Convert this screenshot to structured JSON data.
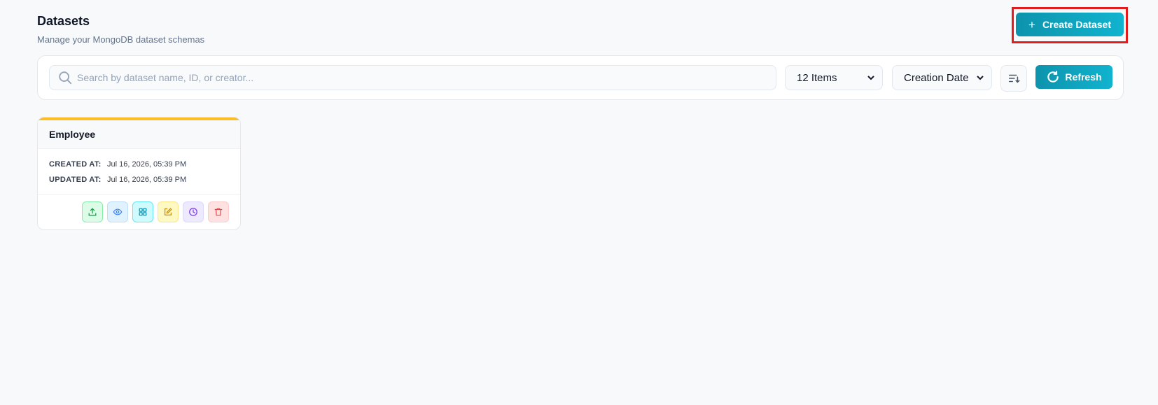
{
  "header": {
    "title": "Datasets",
    "subtitle": "Manage your MongoDB dataset schemas",
    "create_button": "Create Dataset",
    "create_button_icon": "plus-icon"
  },
  "toolbar": {
    "search": {
      "placeholder": "Search by dataset name, ID, or creator...",
      "value": ""
    },
    "page_size": {
      "selected": "12 Items"
    },
    "sort_by": {
      "selected": "Creation Date"
    },
    "sort_direction_icon": "sort-descending-icon",
    "refresh_button": "Refresh"
  },
  "datasets": [
    {
      "name": "Employee",
      "accent_color": "#fbbf24",
      "created_label": "CREATED AT:",
      "created_at": "Jul 16, 2026, 05:39 PM",
      "updated_label": "UPDATED AT:",
      "updated_at": "Jul 16, 2026, 05:39 PM",
      "actions": [
        "upload-icon",
        "eye-icon",
        "grid-icon",
        "edit-icon",
        "clock-icon",
        "trash-icon"
      ]
    }
  ],
  "colors": {
    "primary": "#0e93ac",
    "highlight": "#e11d1d",
    "background": "#f8f9fb"
  }
}
